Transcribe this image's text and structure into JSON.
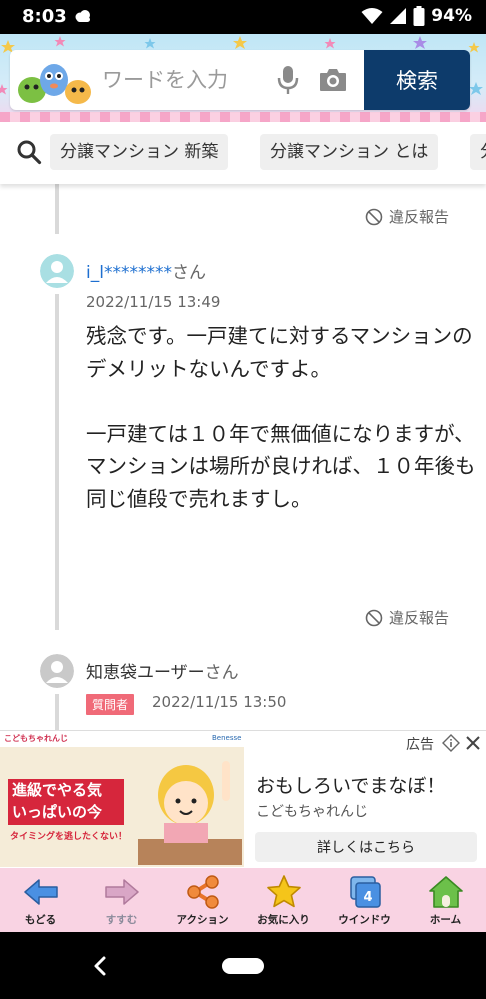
{
  "status_bar": {
    "time": "8:03",
    "battery": "94%"
  },
  "search": {
    "placeholder": "ワードを入力",
    "button_label": "検索"
  },
  "suggestions": [
    "分譲マンション 新築",
    "分譲マンション とは",
    "分"
  ],
  "prev_answer": {
    "report_label": "違反報告"
  },
  "answer": {
    "username": "i_l********",
    "username_suffix": "さん",
    "timestamp": "2022/11/15 13:49",
    "body": "残念です。一戸建てに対するマンションの\nデメリットないんですよ。\n\n一戸建ては１０年で無価値になりますが、\nマンションは場所が良ければ、１０年後も同じ値段で売れますし。",
    "report_label": "違反報告"
  },
  "next_reply": {
    "username": "知恵袋ユーザー",
    "username_suffix": "さん",
    "badge": "質問者",
    "timestamp": "2022/11/15 13:50"
  },
  "ad": {
    "label": "広告",
    "brand_small": "こどもちゃれんじ",
    "brand_benesse": "Benesse",
    "image_line1": "進級でやる気",
    "image_line2": "いっぱいの今",
    "image_line3": "タイミングを逃したくない！",
    "headline": "おもしろいでまなぼ！",
    "sponsor": "こどもちゃれんじ",
    "cta": "詳しくはこちら"
  },
  "toolbar": {
    "items": [
      {
        "label": "もどる"
      },
      {
        "label": "すすむ"
      },
      {
        "label": "アクション"
      },
      {
        "label": "お気に入り"
      },
      {
        "label": "ウインドウ",
        "count": "4"
      },
      {
        "label": "ホーム"
      }
    ]
  },
  "colors": {
    "search_button": "#0d3b6b",
    "toolbar_bg": "#f9d3e3",
    "badge": "#f06a78",
    "accent_blue": "#1e6fd0"
  }
}
